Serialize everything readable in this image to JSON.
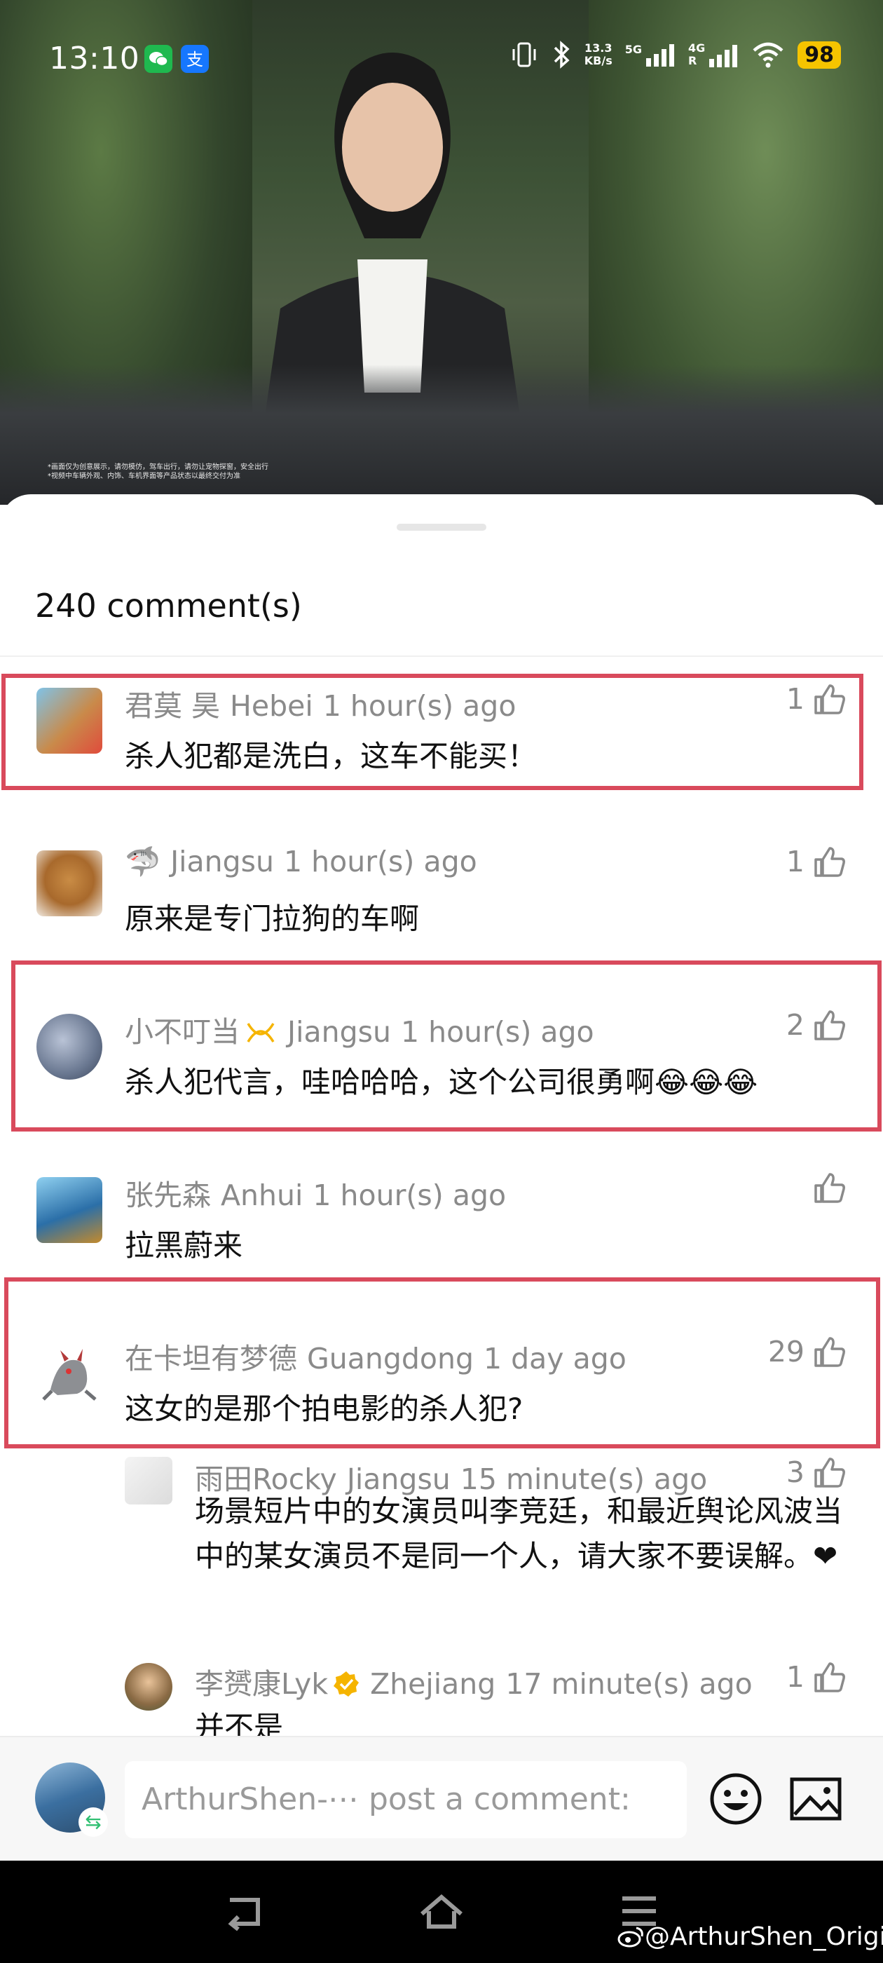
{
  "status_bar": {
    "time": "13:10",
    "net_speed_value": "13.3",
    "net_speed_unit": "KB/s",
    "sig1": "5G",
    "sig2": "4G",
    "sig2_sub": "R",
    "battery": "98"
  },
  "video": {
    "disclaimer_line1": "*画面仅为创意展示，请勿模仿，驾车出行，请勿让宠物探窗，安全出行",
    "disclaimer_line2": "*视频中车辆外观、内饰、车机界面等产品状态以最终交付为准"
  },
  "comments_header": {
    "count_label": "240 comment(s)"
  },
  "comments": [
    {
      "user": "君莫 昊",
      "location": "Hebei",
      "time": "1 hour(s) ago",
      "text": "杀人犯都是洗白，这车不能买！",
      "likes": "1",
      "highlighted": true
    },
    {
      "user": "🦈",
      "location": "Jiangsu",
      "time": "1 hour(s) ago",
      "text": "原来是专门拉狗的车啊",
      "likes": "1",
      "highlighted": false
    },
    {
      "user": "小不叮当",
      "location": "Jiangsu",
      "time": "1 hour(s) ago",
      "text": "杀人犯代言，哇哈哈哈，这个公司很勇啊😂😂😂",
      "likes": "2",
      "highlighted": true
    },
    {
      "user": "张先森",
      "location": "Anhui",
      "time": "1 hour(s) ago",
      "text": "拉黑蔚来",
      "likes": "",
      "highlighted": false
    },
    {
      "user": "在卡坦有梦德",
      "location": "Guangdong",
      "time": "1 day ago",
      "text": "这女的是那个拍电影的杀人犯?",
      "likes": "29",
      "highlighted": true
    }
  ],
  "replies": [
    {
      "user": "雨田Rocky",
      "location": "Jiangsu",
      "time": "15 minute(s) ago",
      "text": "场景短片中的女演员叫李竞廷，和最近舆论风波当中的某女演员不是同一个人，请大家不要误解。❤",
      "likes": "3"
    },
    {
      "user": "李赟康Lyk",
      "location": "Zhejiang",
      "time": "17 minute(s) ago",
      "text": "并不是",
      "likes": "1"
    }
  ],
  "input_bar": {
    "placeholder": "ArthurShen-⋯ post a comment:"
  },
  "watermark": "@ArthurShen_Origin",
  "colors": {
    "highlight": "#d94a5c",
    "battery": "#f5c400",
    "verified": "#f5b400"
  }
}
